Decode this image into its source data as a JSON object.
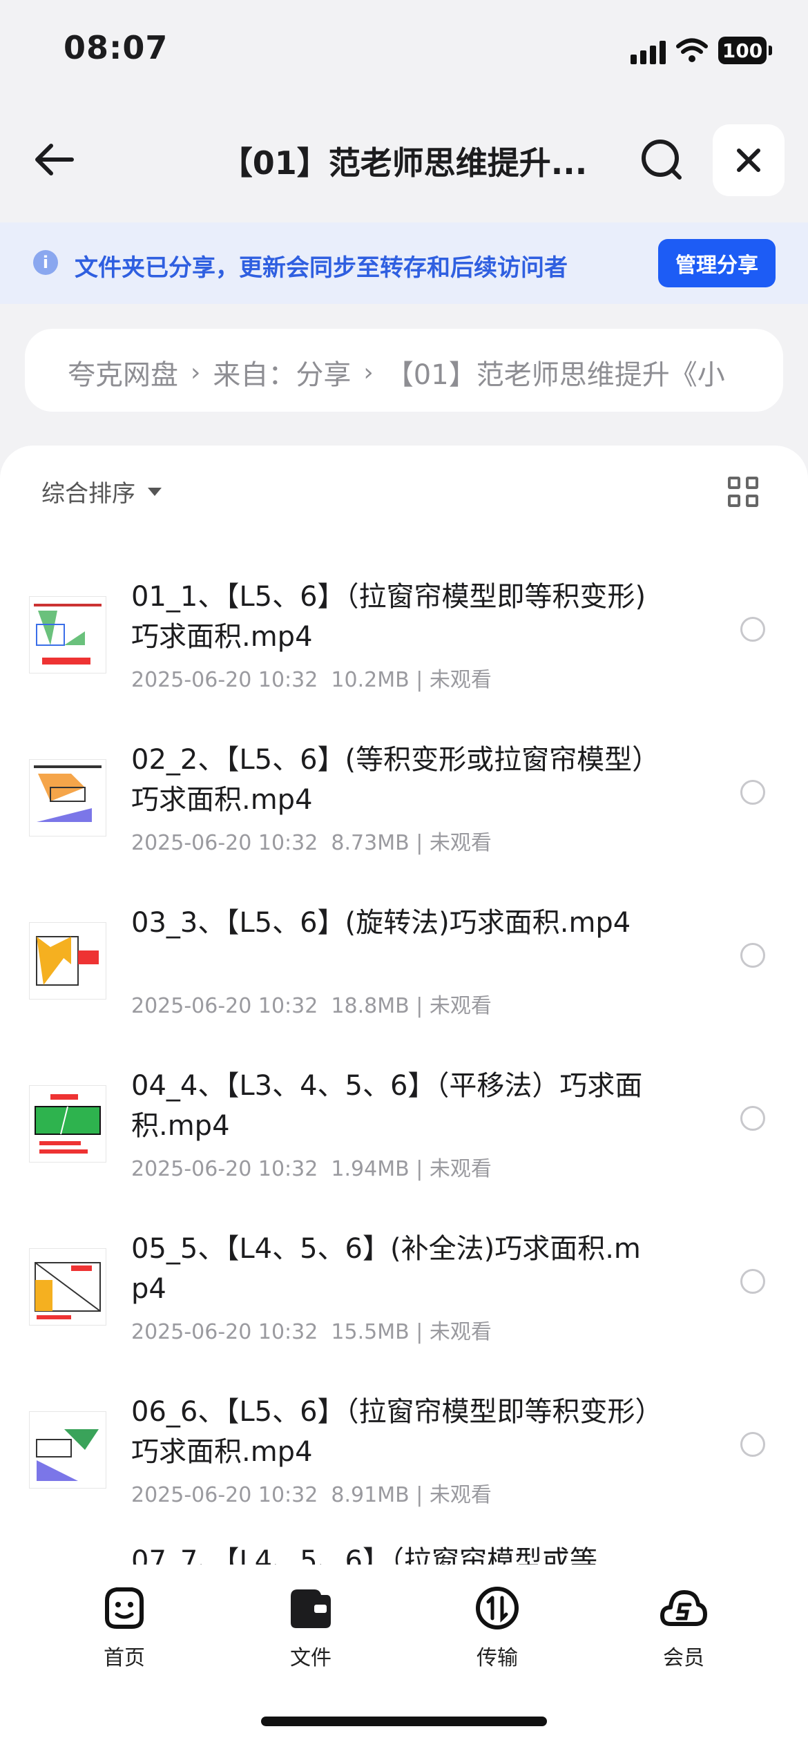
{
  "status": {
    "time": "08:07",
    "battery": "100"
  },
  "nav": {
    "title": "【01】范老师思维提升..."
  },
  "banner": {
    "message": "文件夹已分享，更新会同步至转存和后续访问者",
    "manage_label": "管理分享"
  },
  "breadcrumb": {
    "items": [
      "夸克网盘",
      "来自：分享",
      "【01】范老师思维提升《小"
    ]
  },
  "toolbar": {
    "sort_label": "综合排序"
  },
  "files": [
    {
      "name": "01_1、【L5、6】（拉窗帘模型即等积变形)巧求面积.mp4",
      "date": "2025-06-20 10:32",
      "size": "10.2MB",
      "status": "未观看"
    },
    {
      "name": "02_2、【L5、6】(等积变形或拉窗帘模型）巧求面积.mp4",
      "date": "2025-06-20 10:32",
      "size": "8.73MB",
      "status": "未观看"
    },
    {
      "name": "03_3、【L5、6】(旋转法)巧求面积.mp4",
      "date": "2025-06-20 10:32",
      "size": "18.8MB",
      "status": "未观看"
    },
    {
      "name": "04_4、【L3、4、5、6】（平移法）巧求面积.mp4",
      "date": "2025-06-20 10:32",
      "size": "1.94MB",
      "status": "未观看"
    },
    {
      "name": "05_5、【L4、5、6】(补全法)巧求面积.mp4",
      "date": "2025-06-20 10:32",
      "size": "15.5MB",
      "status": "未观看"
    },
    {
      "name": "06_6、【L5、6】（拉窗帘模型即等积变形）巧求面积.mp4",
      "date": "2025-06-20 10:32",
      "size": "8.91MB",
      "status": "未观看"
    }
  ],
  "partial_item": "07_7、【L4、5、6】（拉窗帘模型或等",
  "tabs": [
    {
      "label": "首页",
      "icon": "smile-face-icon"
    },
    {
      "label": "文件",
      "icon": "folder-icon"
    },
    {
      "label": "传输",
      "icon": "transfer-icon"
    },
    {
      "label": "会员",
      "icon": "cloud-member-icon"
    }
  ],
  "colors": {
    "accent": "#1d5cf5",
    "banner_bg": "#e9eefb",
    "banner_text": "#2f5fe0"
  }
}
